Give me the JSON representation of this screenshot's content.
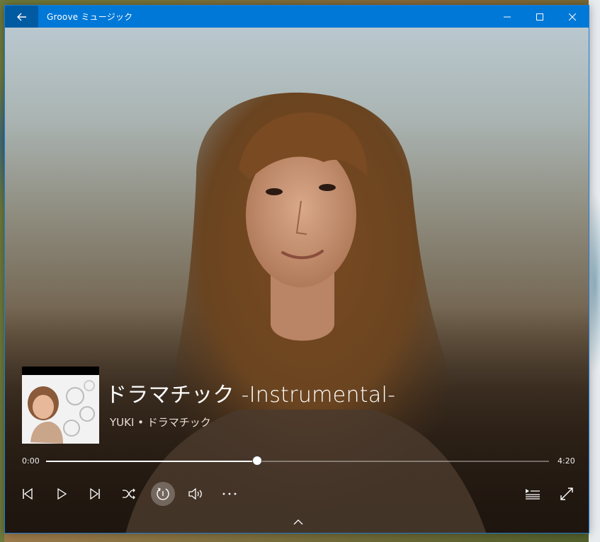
{
  "window": {
    "title": "Groove ミュージック"
  },
  "now_playing": {
    "title": "ドラマチック -Instrumental-",
    "artist_album": "YUKI • ドラマチック",
    "time_current": "0:00",
    "time_total": "4:20",
    "progress_fraction": 0.42
  },
  "icons": {
    "back": "back-arrow-icon",
    "minimize": "minimize-icon",
    "maximize": "maximize-icon",
    "close": "close-icon",
    "previous": "previous-track-icon",
    "play": "play-icon",
    "next": "next-track-icon",
    "shuffle": "shuffle-icon",
    "repeat": "repeat-one-icon",
    "volume": "volume-icon",
    "more": "more-icon",
    "queue": "now-playing-list-icon",
    "fullscreen": "fullscreen-icon",
    "expand": "chevron-up-icon"
  },
  "colors": {
    "titlebar": "#0078d7",
    "back_button": "#005ba3",
    "text": "#ffffff"
  }
}
